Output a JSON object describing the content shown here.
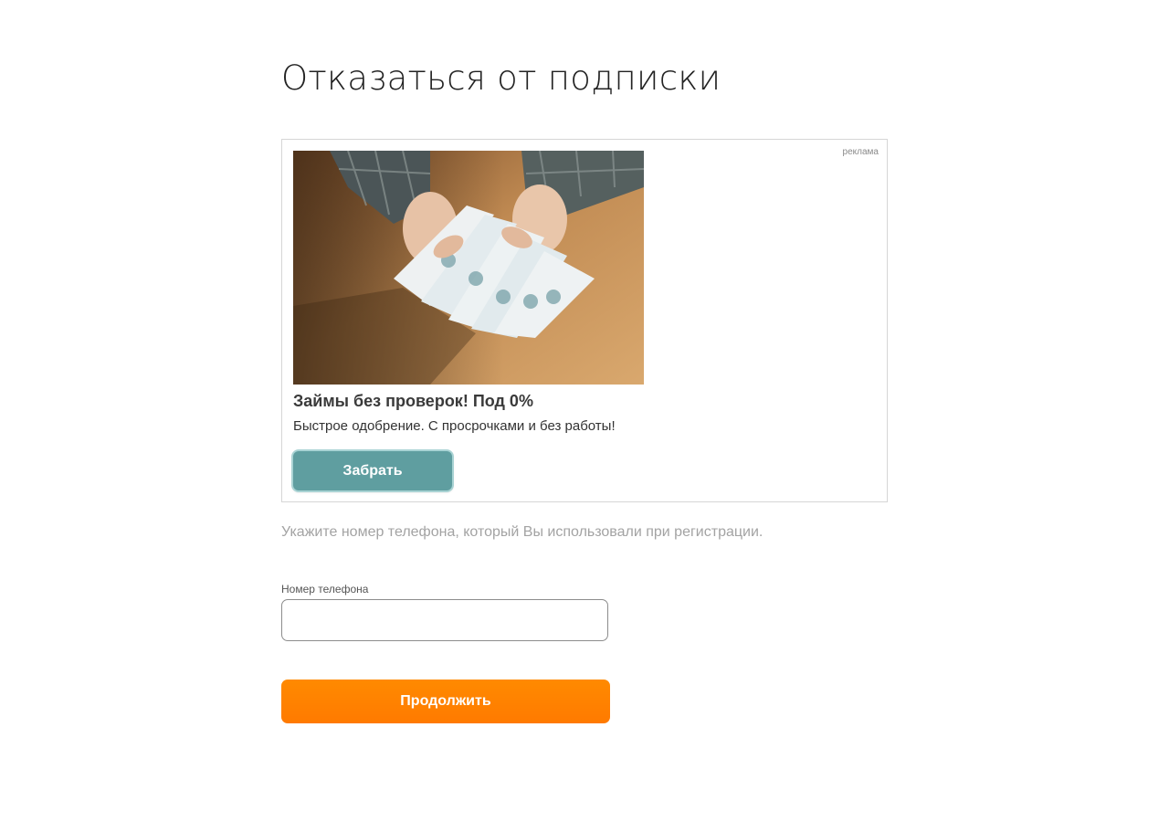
{
  "page": {
    "title": "Отказаться от подписки"
  },
  "ad": {
    "label": "реклама",
    "headline": "Займы без проверок! Под 0%",
    "text": "Быстрое одобрение. С просрочками и без работы!",
    "button_label": "Забрать",
    "image_icon": "money-photo",
    "button_color": "#5f9ea0"
  },
  "form": {
    "hint": "Укажите номер телефона, который Вы использовали при регистрации.",
    "phone_label": "Номер телефона",
    "phone_value": "",
    "phone_placeholder": "",
    "continue_label": "Продолжить",
    "continue_color": "#ff8000"
  }
}
